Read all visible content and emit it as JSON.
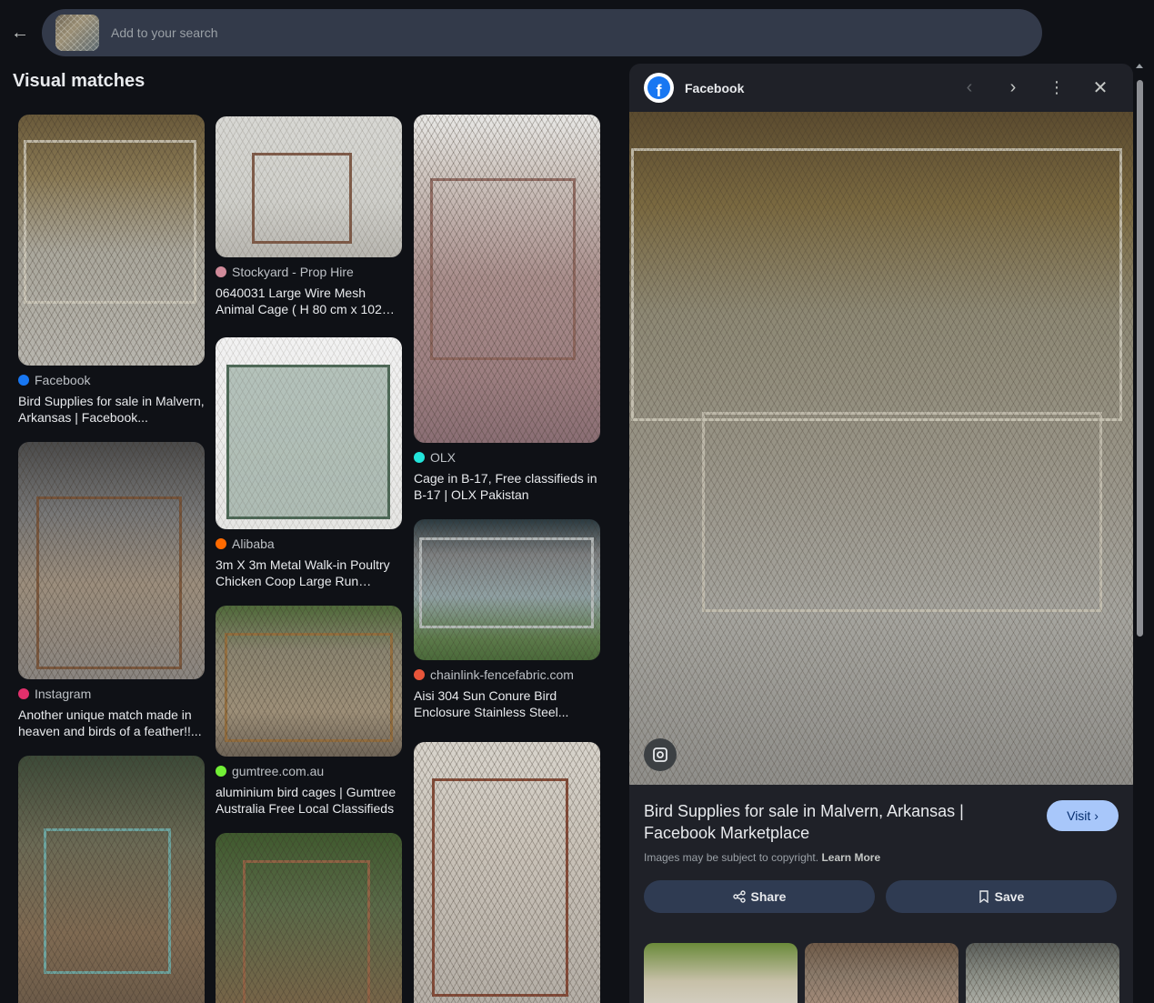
{
  "search": {
    "placeholder": "Add to your search"
  },
  "section_title": "Visual matches",
  "results": [
    {
      "source": "Facebook",
      "title": "Bird Supplies for sale in Malvern, Arkansas | Facebook...",
      "icon": "facebook-icon",
      "icon_color": "#1877f2"
    },
    {
      "source": "Stockyard - Prop Hire",
      "title": "0640031 Large Wire Mesh Animal Cage ( H 80 cm x 102 x...",
      "icon": "stockyard-icon",
      "icon_color": "#d08a9a"
    },
    {
      "source": "OLX",
      "title": "Cage in B-17, Free classifieds in B-17 | OLX Pakistan",
      "icon": "olx-icon",
      "icon_color": "#23e5db"
    },
    {
      "source": "Instagram",
      "title": "Another unique match made in heaven and birds of a feather!!...",
      "icon": "instagram-icon",
      "icon_color": "#e1306c"
    },
    {
      "source": "Alibaba",
      "title": "3m X 3m Metal Walk-in Poultry Chicken Coop Large Run Cage...",
      "icon": "alibaba-icon",
      "icon_color": "#ff6a00"
    },
    {
      "source": "chainlink-fencefabric.com",
      "title": "Aisi 304 Sun Conure Bird Enclosure Stainless Steel...",
      "icon": "chainlink-icon",
      "icon_color": "#e8553a"
    },
    {
      "source": "gumtree.com.au",
      "title": "aluminium bird cages | Gumtree Australia Free Local Classifieds",
      "icon": "gumtree-icon",
      "icon_color": "#72ef36"
    }
  ],
  "panel": {
    "source": "Facebook",
    "title": "Bird Supplies for sale in Malvern, Arkansas | Facebook Marketplace",
    "visit_label": "Visit",
    "copyright_text": "Images may be subject to copyright.",
    "learn_more": "Learn More",
    "share_label": "Share",
    "save_label": "Save"
  }
}
